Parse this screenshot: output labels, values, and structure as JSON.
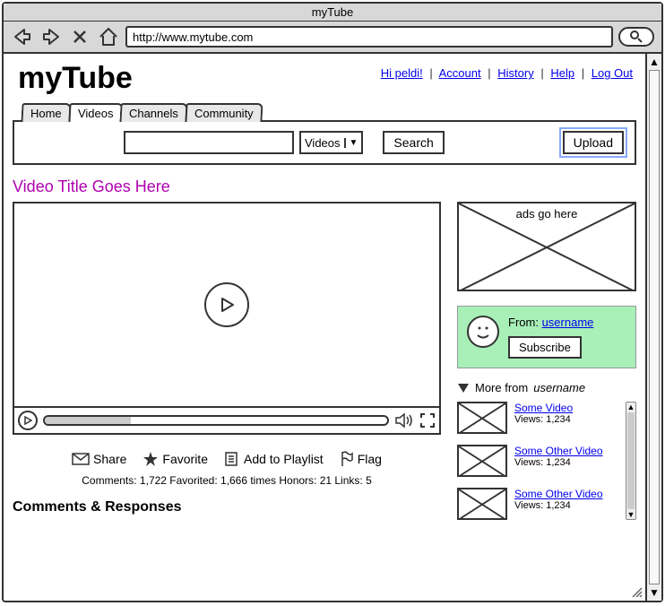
{
  "window": {
    "title": "myTube",
    "url": "http://www.mytube.com"
  },
  "logo": "myTube",
  "headerLinks": {
    "greeting": "Hi peldi!",
    "account": "Account",
    "history": "History",
    "help": "Help",
    "logout": "Log Out"
  },
  "tabs": {
    "home": "Home",
    "videos": "Videos",
    "channels": "Channels",
    "community": "Community"
  },
  "search": {
    "selector": "Videos",
    "button": "Search",
    "upload": "Upload"
  },
  "video": {
    "title": "Video Title Goes Here",
    "actions": {
      "share": "Share",
      "favorite": "Favorite",
      "playlist": "Add to Playlist",
      "flag": "Flag"
    },
    "stats": "Comments: 1,722  Favorited: 1,666 times  Honors: 21  Links: 5"
  },
  "commentsHeader": "Comments & Responses",
  "ads": {
    "label": "ads go here"
  },
  "uploader": {
    "fromLabel": "From:",
    "username": "username",
    "subscribe": "Subscribe",
    "morePrefix": "More from",
    "moreName": "username"
  },
  "related": [
    {
      "title": "Some Video",
      "views": "Views: 1,234"
    },
    {
      "title": "Some Other Video",
      "views": "Views: 1,234"
    },
    {
      "title": "Some Other Video",
      "views": "Views: 1,234"
    }
  ]
}
